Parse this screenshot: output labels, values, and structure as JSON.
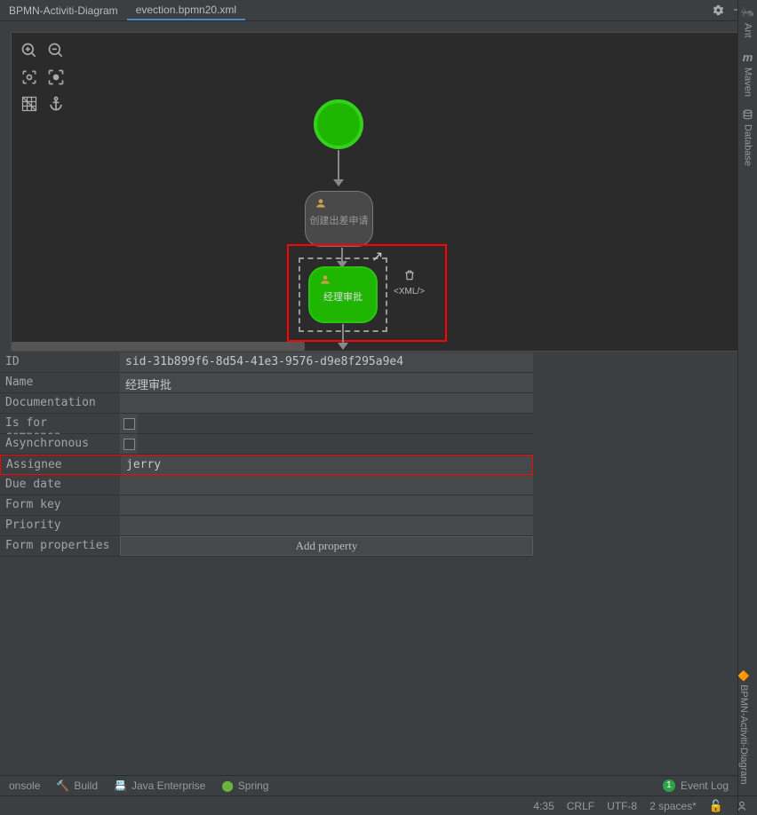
{
  "tabs": {
    "context": "BPMN-Activiti-Diagram",
    "active": "evection.bpmn20.xml"
  },
  "diagram": {
    "task1_label": "创建出差申请",
    "task2_label": "经理审批",
    "xml_label": "<XML/>"
  },
  "properties": {
    "rows": {
      "id": {
        "label": "ID",
        "value": "sid-31b899f6-8d54-41e3-9576-d9e8f295a9e4"
      },
      "name": {
        "label": "Name",
        "value": "经理审批"
      },
      "documentation": {
        "label": "Documentation",
        "value": ""
      },
      "compensation": {
        "label": "Is for compensa...",
        "checked": false
      },
      "asynchronous": {
        "label": "Asynchronous",
        "checked": false
      },
      "assignee": {
        "label": "Assignee",
        "value": "jerry"
      },
      "due_date": {
        "label": "Due date",
        "value": ""
      },
      "form_key": {
        "label": "Form key",
        "value": ""
      },
      "priority": {
        "label": "Priority",
        "value": ""
      },
      "form_properties": {
        "label": "Form properties",
        "button": "Add property"
      }
    }
  },
  "right_sidebar": {
    "items": [
      "Ant",
      "Maven",
      "Database"
    ],
    "bottom": "BPMN-Activiti-Diagram"
  },
  "bottom_tools": {
    "items": [
      "onsole",
      "Build",
      "Java Enterprise",
      "Spring"
    ],
    "event_log": "Event Log",
    "badge": "1"
  },
  "status_bar": {
    "pos": "4:35",
    "line_sep": "CRLF",
    "encoding": "UTF-8",
    "indent": "2 spaces*"
  }
}
